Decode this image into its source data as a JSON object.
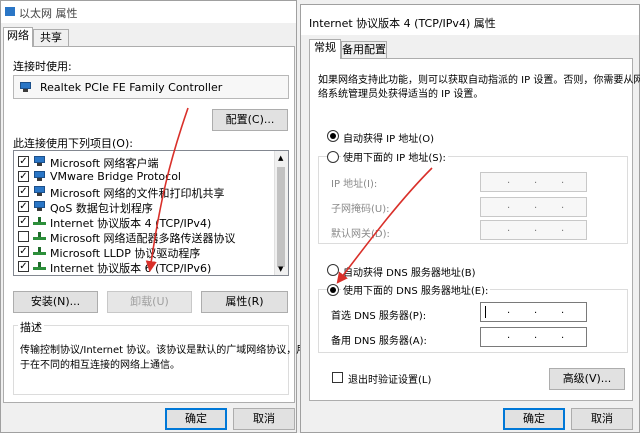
{
  "left_window": {
    "title": "以太网 属性",
    "tabs": [
      {
        "label": "网络"
      },
      {
        "label": "共享"
      }
    ],
    "connect_using_label": "连接时使用:",
    "adapter_name": "Realtek PCIe FE Family Controller",
    "configure_button": "配置(C)...",
    "items_label": "此连接使用下列项目(O):",
    "items": [
      {
        "label": "Microsoft 网络客户端",
        "checked": true,
        "icon": "network-client-icon"
      },
      {
        "label": "VMware Bridge Protocol",
        "checked": true,
        "icon": "network-client-icon"
      },
      {
        "label": "Microsoft 网络的文件和打印机共享",
        "checked": true,
        "icon": "network-client-icon"
      },
      {
        "label": "QoS 数据包计划程序",
        "checked": true,
        "icon": "network-client-icon"
      },
      {
        "label": "Internet 协议版本 4 (TCP/IPv4)",
        "checked": true,
        "icon": "protocol-icon"
      },
      {
        "label": "Microsoft 网络适配器多路传送器协议",
        "checked": false,
        "icon": "protocol-icon"
      },
      {
        "label": "Microsoft LLDP 协议驱动程序",
        "checked": true,
        "icon": "protocol-icon"
      },
      {
        "label": "Internet 协议版本 6 (TCP/IPv6)",
        "checked": true,
        "icon": "protocol-icon"
      }
    ],
    "install_button": "安装(N)...",
    "uninstall_button": "卸载(U)",
    "properties_button": "属性(R)",
    "description_label": "描述",
    "description_line1": "传输控制协议/Internet 协议。该协议是默认的广域网络协议，用",
    "description_line2": "于在不同的相互连接的网络上通信。",
    "ok_button": "确定",
    "cancel_button": "取消"
  },
  "right_window": {
    "title": "Internet 协议版本 4 (TCP/IPv4) 属性",
    "tabs": [
      {
        "label": "常规"
      },
      {
        "label": "备用配置"
      }
    ],
    "intro_line1": "如果网络支持此功能，则可以获取自动指派的 IP 设置。否则，你需要从网",
    "intro_line2": "络系统管理员处获得适当的 IP 设置。",
    "auto_ip_label": "自动获得 IP 地址(O)",
    "manual_ip_label": "使用下面的 IP 地址(S):",
    "ip_address_label": "IP 地址(I):",
    "subnet_label": "子网掩码(U):",
    "gateway_label": "默认网关(D):",
    "auto_dns_label": "自动获得 DNS 服务器地址(B)",
    "manual_dns_label": "使用下面的 DNS 服务器地址(E):",
    "preferred_dns_label": "首选 DNS 服务器(P):",
    "alternate_dns_label": "备用 DNS 服务器(A):",
    "validate_label": "退出时验证设置(L)",
    "advanced_button": "高级(V)...",
    "ok_button": "确定",
    "cancel_button": "取消",
    "ip_dot": "."
  },
  "colors": {
    "annotation_arrow": "#d9302a",
    "focus_border": "#0078d7"
  }
}
